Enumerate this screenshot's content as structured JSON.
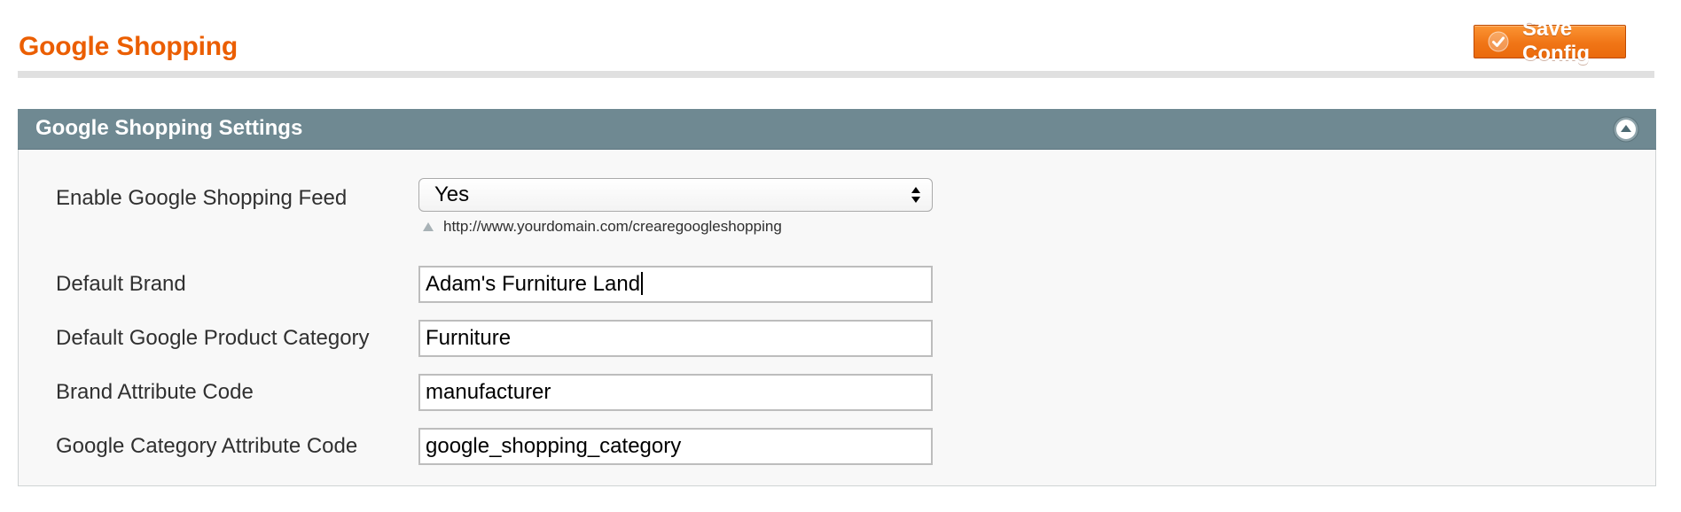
{
  "page": {
    "title": "Google Shopping",
    "save_label": "Save Config"
  },
  "section": {
    "title": "Google Shopping Settings",
    "fields": [
      {
        "label": "Enable Google Shopping Feed",
        "value": "Yes",
        "note": "http://www.yourdomain.com/crearegoogleshopping"
      },
      {
        "label": "Default Brand",
        "value": "Adam's Furniture Land"
      },
      {
        "label": "Default Google Product Category",
        "value": "Furniture"
      },
      {
        "label": "Brand Attribute Code",
        "value": "manufacturer"
      },
      {
        "label": "Google Category Attribute Code",
        "value": "google_shopping_category"
      }
    ]
  },
  "icons": {
    "save": "check-circle-icon",
    "collapse": "chevron-up-circle-icon",
    "select_arrows": "up-down-arrows-icon",
    "note": "triangle-up-icon"
  },
  "colors": {
    "title": "#eb5e00",
    "button": "#f07516",
    "section_header": "#6f8992"
  }
}
